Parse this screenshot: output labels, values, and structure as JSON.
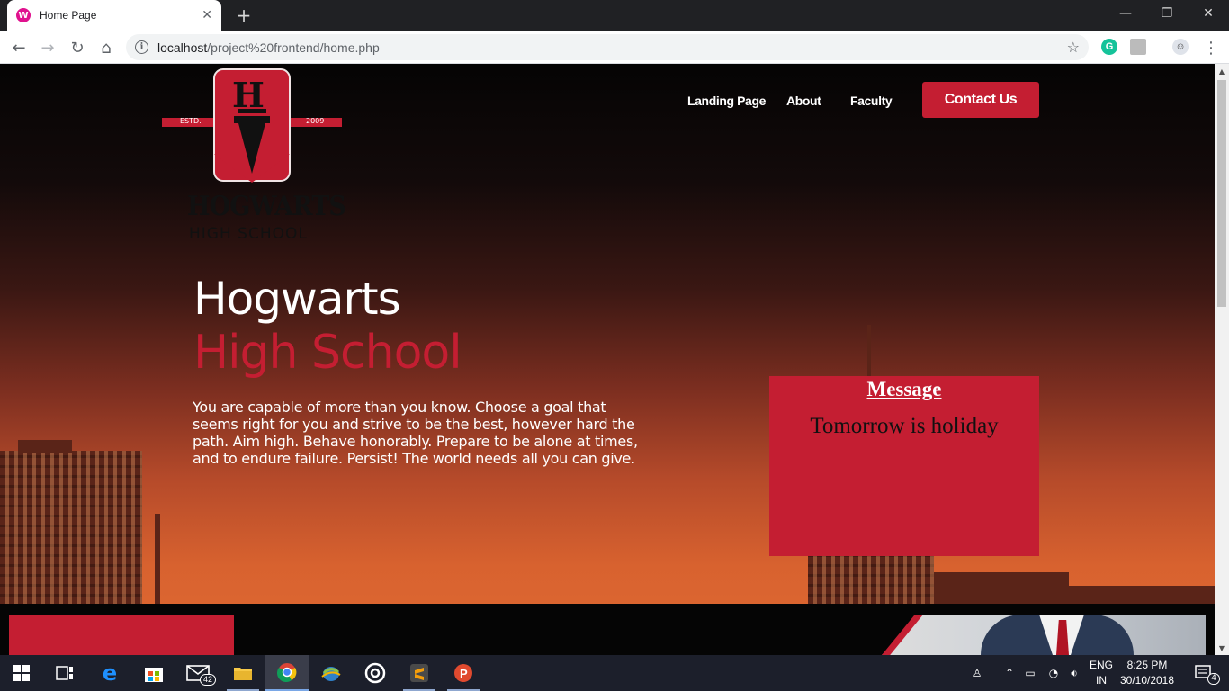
{
  "browser": {
    "tab_title": "Home Page",
    "tab_favicon": "W",
    "url_host": "localhost",
    "url_path": "/project%20frontend/home.php"
  },
  "site": {
    "logo": {
      "letter": "H",
      "left_ribbon": "ESTD.",
      "right_ribbon": "2009",
      "caption_line1": "HOGWARTS",
      "caption_line2": "HIGH SCHOOL"
    },
    "nav": {
      "landing": "Landing Page",
      "about": "About",
      "faculty": "Faculty",
      "contact": "Contact Us"
    },
    "hero": {
      "line1": "Hogwarts",
      "line2": "High School",
      "text": "You are capable of more than you know. Choose a goal that seems right for you and strive to be the best, however hard the path. Aim high. Behave honorably. Prepare to be alone at times, and to endure failure. Persist! The world needs all you can give."
    },
    "message": {
      "title": "Message",
      "body": "Tomorrow is holiday"
    },
    "colors": {
      "accent": "#c41e32"
    }
  },
  "taskbar": {
    "mail_badge": "42",
    "lang_line1": "ENG",
    "lang_line2": "IN",
    "time": "8:25 PM",
    "date": "30/10/2018",
    "notification_count": "4"
  }
}
